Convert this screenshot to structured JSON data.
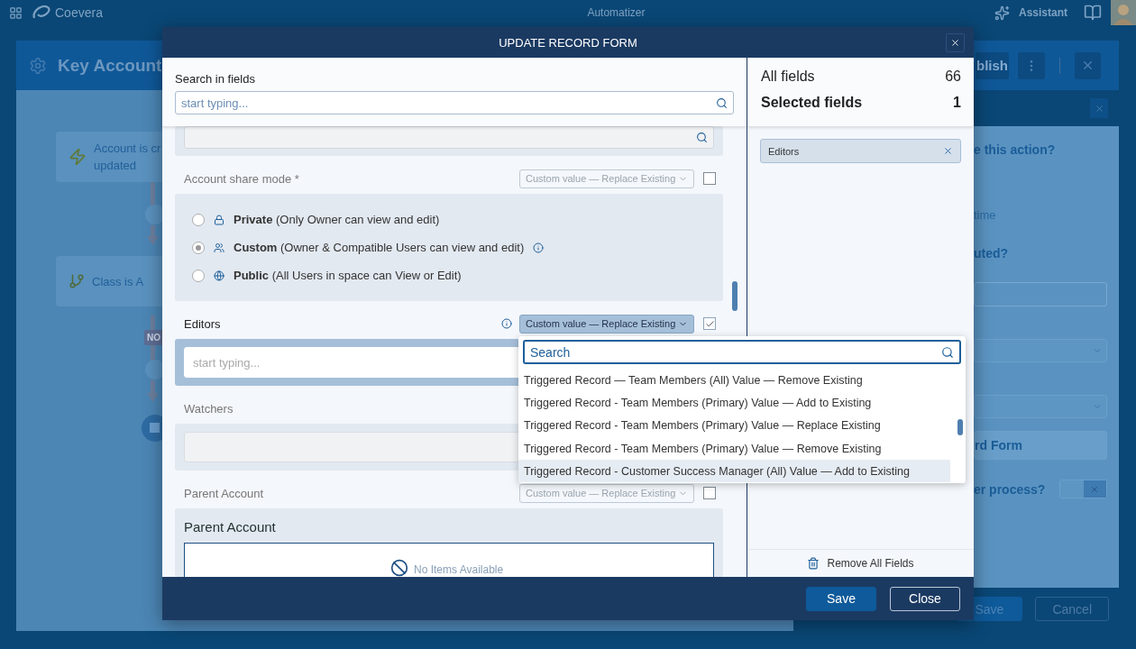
{
  "topbar": {
    "logo": "Coevera",
    "app": "Automatizer",
    "assistant": "Assistant"
  },
  "editor": {
    "title": "Key Account",
    "publish": "blish",
    "nodes": [
      {
        "kind": "trigger",
        "text": "Account is cr\nupdated"
      },
      {
        "kind": "condition",
        "text": "Class is A"
      }
    ],
    "branch_label": "NO"
  },
  "side_panel": {
    "lines": [
      {
        "kind": "question",
        "text": "e this action?"
      },
      {
        "kind": "option",
        "text": "time"
      },
      {
        "kind": "question",
        "text": "uted?"
      },
      {
        "kind": "input"
      },
      {
        "kind": "select"
      },
      {
        "kind": "select"
      },
      {
        "kind": "button",
        "text": "rd Form"
      },
      {
        "kind": "toggle",
        "text": "er process?",
        "on": false
      }
    ],
    "buttons": [
      {
        "label": "Save",
        "kind": "primary"
      },
      {
        "label": "Cancel",
        "kind": "secondary"
      }
    ]
  },
  "modal": {
    "title": "UPDATE RECORD FORM",
    "search_label": "Search in fields",
    "search_placeholder": "start typing...",
    "fields": [
      {
        "kind": "search"
      },
      {
        "kind": "radio",
        "label": "Account share mode *",
        "mode": "Custom value — Replace Existing",
        "checked": false,
        "options": [
          {
            "name": "Private",
            "note": "(Only Owner can view and edit)",
            "selected": false
          },
          {
            "name": "Custom",
            "note": "(Owner & Compatible Users can view and edit)",
            "info": true,
            "selected": true
          },
          {
            "name": "Public",
            "note": "(All Users in space can View or Edit)",
            "selected": false
          }
        ]
      },
      {
        "kind": "people",
        "label": "Editors",
        "mode": "Custom value — Replace Existing",
        "checked": true,
        "info": true,
        "placeholder": "start typing..."
      },
      {
        "kind": "people",
        "label": "Watchers"
      },
      {
        "kind": "lookup",
        "label": "Parent Account",
        "mode": "Custom value — Replace Existing",
        "checked": false,
        "title": "Parent Account",
        "empty": "No Items Available"
      }
    ],
    "summary": [
      {
        "kind": "total",
        "label": "All fields",
        "count": "66"
      },
      {
        "kind": "selected",
        "label": "Selected fields",
        "count": "1"
      }
    ],
    "chips": [
      {
        "label": "Editors"
      }
    ],
    "remove_all": "Remove All Fields",
    "buttons": [
      {
        "label": "Save",
        "kind": "primary"
      },
      {
        "label": "Close",
        "kind": "secondary"
      }
    ]
  },
  "dropdown": {
    "placeholder": "Search",
    "options": [
      {
        "label": "Triggered Record — Team Members (All) Value — Remove Existing",
        "selected": false
      },
      {
        "label": "Triggered Record - Team Members (Primary) Value — Add to Existing",
        "selected": false
      },
      {
        "label": "Triggered Record - Team Members (Primary) Value — Replace Existing",
        "selected": false
      },
      {
        "label": "Triggered Record - Team Members (Primary) Value — Remove Existing",
        "selected": false
      },
      {
        "label": "Triggered Record - Customer Success Manager (All) Value — Add to Existing",
        "selected": true
      }
    ]
  }
}
